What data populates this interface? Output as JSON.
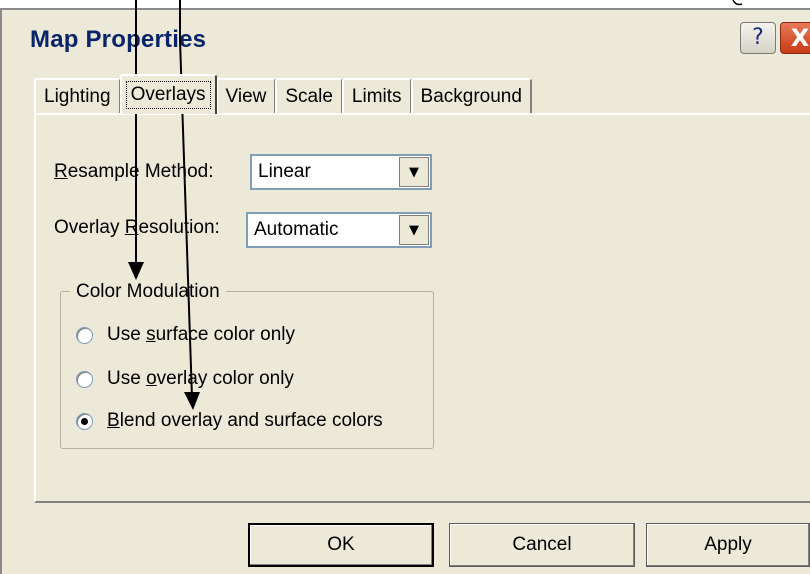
{
  "window": {
    "title": "Map Properties",
    "help_label": "?",
    "close_label": "X"
  },
  "tabs": [
    {
      "label": "Lighting",
      "active": false
    },
    {
      "label": "Overlays",
      "active": true
    },
    {
      "label": "View",
      "active": false
    },
    {
      "label": "Scale",
      "active": false
    },
    {
      "label": "Limits",
      "active": false
    },
    {
      "label": "Background",
      "active": false
    }
  ],
  "resample": {
    "label_access": "R",
    "label_rest": "esample Method:",
    "value": "Linear"
  },
  "overlay_resolution": {
    "label_pre": "Overlay ",
    "label_access": "R",
    "label_rest": "esolution:",
    "value": "Automatic"
  },
  "color_modulation": {
    "title": "Color Modulation",
    "options": [
      {
        "pre": "Use ",
        "access": "s",
        "post": "urface color only",
        "checked": false
      },
      {
        "pre": "Use ",
        "access": "o",
        "post": "verlay color only",
        "checked": false
      },
      {
        "pre": "",
        "access": "B",
        "post": "lend overlay and surface colors",
        "checked": true
      }
    ]
  },
  "buttons": {
    "ok": "OK",
    "cancel": "Cancel",
    "apply": "Apply"
  },
  "icons": {
    "combo_arrow": "▼",
    "help": "question-icon",
    "close": "close-icon"
  },
  "colors": {
    "title_text": "#0a246a",
    "close_button": "#c63a16",
    "dialog_face": "#ece9d8"
  }
}
